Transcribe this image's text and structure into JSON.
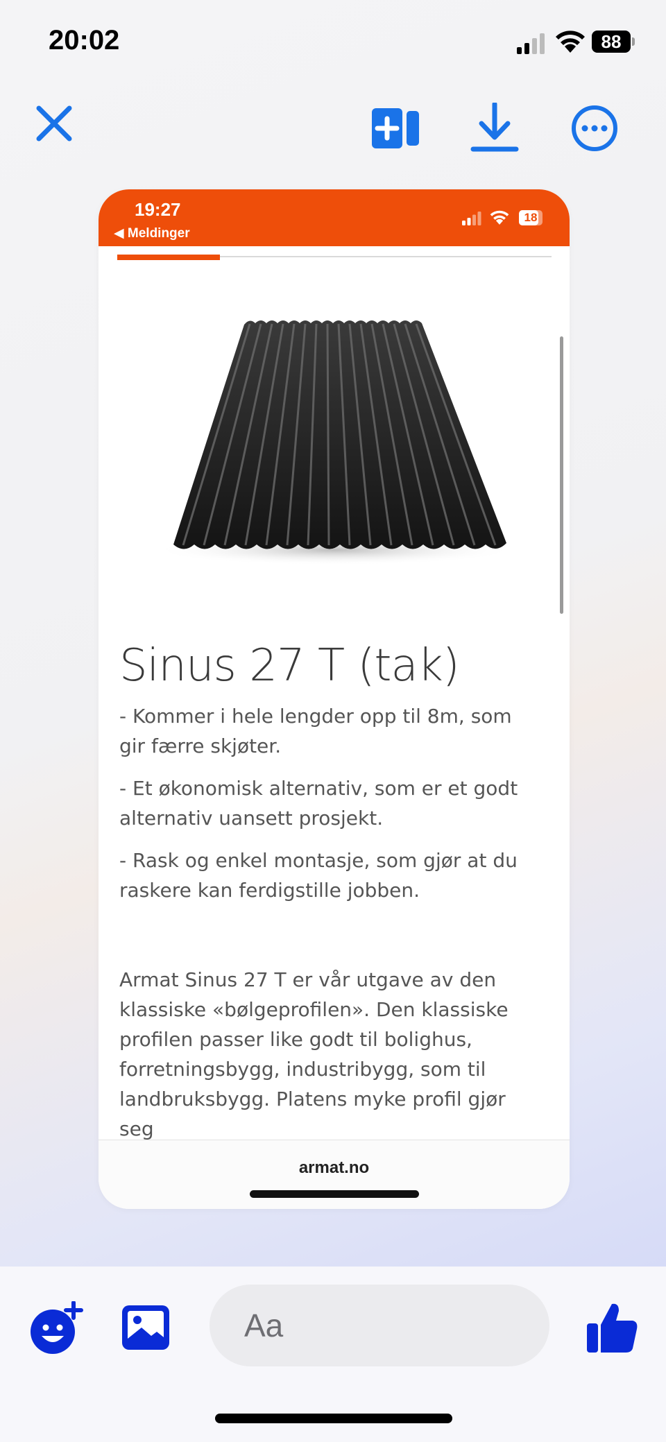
{
  "status_bar": {
    "time": "20:02",
    "battery": "88"
  },
  "colors": {
    "accent": "#1a73e8",
    "messenger_blue": "#0a2bd6",
    "brand_orange": "#ee4e0a"
  },
  "toolbar": {
    "close_icon": "close-icon",
    "add_icon": "add-to-collection-icon",
    "download_icon": "download-icon",
    "more_icon": "more-options-icon"
  },
  "screenshot": {
    "status": {
      "time": "19:27",
      "back_label": "◀ Meldinger",
      "battery": "18"
    },
    "product": {
      "title": "Sinus 27 T (tak)",
      "bullets": [
        "- Kommer i hele lengder opp til 8m, som gir færre skjøter.",
        "- Et økonomisk alternativ, som er et godt alternativ uansett prosjekt.",
        "- Rask og enkel montasje, som gjør at du raskere kan ferdigstille jobben."
      ],
      "description": "Armat Sinus 27 T er vår utgave av den klassiske «bølgeprofilen». Den klassiske profilen passer like godt til bolighus, forretningsbygg, industribygg, som til landbruksbygg. Platens myke profil gjør seg"
    },
    "footer_url": "armat.no"
  },
  "composer": {
    "placeholder": "Aa"
  }
}
